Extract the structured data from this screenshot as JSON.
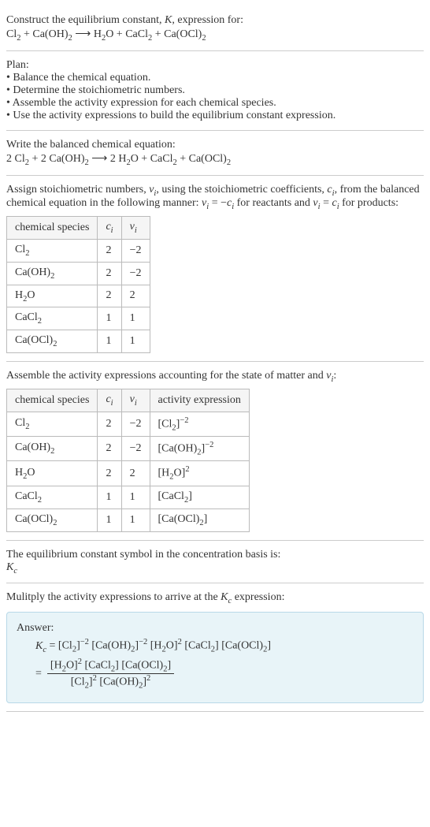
{
  "intro": {
    "line1": "Construct the equilibrium constant, K, expression for:",
    "equation_lhs": "Cl₂ + Ca(OH)₂",
    "equation_rhs": "H₂O + CaCl₂ + Ca(OCl)₂"
  },
  "plan": {
    "heading": "Plan:",
    "items": [
      "Balance the chemical equation.",
      "Determine the stoichiometric numbers.",
      "Assemble the activity expression for each chemical species.",
      "Use the activity expressions to build the equilibrium constant expression."
    ]
  },
  "balanced": {
    "heading": "Write the balanced chemical equation:",
    "lhs": "2 Cl₂ + 2 Ca(OH)₂",
    "rhs": "2 H₂O + CaCl₂ + Ca(OCl)₂"
  },
  "stoich": {
    "text_a": "Assign stoichiometric numbers, νᵢ, using the stoichiometric coefficients, cᵢ, from the balanced chemical equation in the following manner: νᵢ = −cᵢ for reactants and νᵢ = cᵢ for products:",
    "headers": [
      "chemical species",
      "cᵢ",
      "νᵢ"
    ],
    "rows": [
      {
        "species": "Cl₂",
        "c": "2",
        "v": "−2"
      },
      {
        "species": "Ca(OH)₂",
        "c": "2",
        "v": "−2"
      },
      {
        "species": "H₂O",
        "c": "2",
        "v": "2"
      },
      {
        "species": "CaCl₂",
        "c": "1",
        "v": "1"
      },
      {
        "species": "Ca(OCl)₂",
        "c": "1",
        "v": "1"
      }
    ]
  },
  "activity": {
    "heading": "Assemble the activity expressions accounting for the state of matter and νᵢ:",
    "headers": [
      "chemical species",
      "cᵢ",
      "νᵢ",
      "activity expression"
    ],
    "rows": [
      {
        "species": "Cl₂",
        "c": "2",
        "v": "−2",
        "expr": "[Cl₂]⁻²"
      },
      {
        "species": "Ca(OH)₂",
        "c": "2",
        "v": "−2",
        "expr": "[Ca(OH)₂]⁻²"
      },
      {
        "species": "H₂O",
        "c": "2",
        "v": "2",
        "expr": "[H₂O]²"
      },
      {
        "species": "CaCl₂",
        "c": "1",
        "v": "1",
        "expr": "[CaCl₂]"
      },
      {
        "species": "Ca(OCl)₂",
        "c": "1",
        "v": "1",
        "expr": "[Ca(OCl)₂]"
      }
    ]
  },
  "symbol": {
    "line1": "The equilibrium constant symbol in the concentration basis is:",
    "line2": "K𝒸"
  },
  "multiply": {
    "heading": "Mulitply the activity expressions to arrive at the K𝒸 expression:"
  },
  "answer": {
    "label": "Answer:",
    "eq1": "K𝒸 = [Cl₂]⁻² [Ca(OH)₂]⁻² [H₂O]² [CaCl₂] [Ca(OCl)₂]",
    "frac_num": "[H₂O]² [CaCl₂] [Ca(OCl)₂]",
    "frac_den": "[Cl₂]² [Ca(OH)₂]²",
    "equals": " = "
  }
}
